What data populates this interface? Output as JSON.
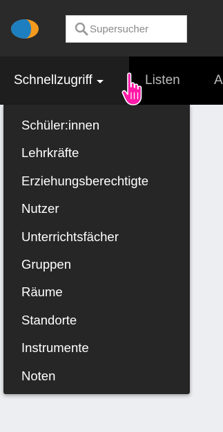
{
  "header": {
    "logo_icon": "app-logo-icon",
    "search": {
      "placeholder": "Supersucher",
      "icon": "search-icon"
    }
  },
  "navbar": {
    "items": [
      {
        "label": "Schnellzugriff",
        "active": true,
        "has_dropdown": true
      },
      {
        "label": "Listen"
      },
      {
        "label": "A"
      }
    ]
  },
  "dropdown": {
    "items": [
      {
        "label": "Schüler:innen"
      },
      {
        "label": "Lehrkräfte"
      },
      {
        "label": "Erziehungsberechtigte"
      },
      {
        "label": "Nutzer"
      },
      {
        "label": "Unterrichtsfächer"
      },
      {
        "label": "Gruppen"
      },
      {
        "label": "Räume"
      },
      {
        "label": "Standorte"
      },
      {
        "label": "Instrumente"
      },
      {
        "label": "Noten"
      }
    ]
  },
  "colors": {
    "topbar": "#2a2a2a",
    "navbar": "#000000",
    "dropdown": "#262626",
    "cursor": "#ff1aa8",
    "logo_orange": "#f39a1e",
    "logo_blue": "#1e7fc0"
  },
  "cursor_icon": "hand-pointer-icon"
}
